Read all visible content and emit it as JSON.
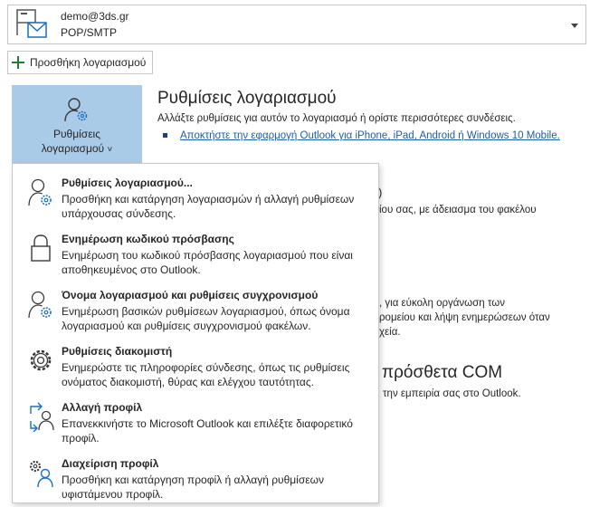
{
  "account": {
    "email": "demo@3ds.gr",
    "type": "POP/SMTP"
  },
  "add_account": {
    "label": "Προσθήκη λογαριασμού"
  },
  "big_button": {
    "line1": "Ρυθμίσεις",
    "line2": "λογαριασμού",
    "chevron": "˅"
  },
  "section": {
    "title": "Ρυθμίσεις λογαριασμού",
    "description": "Αλλάξτε ρυθμίσεις για αυτόν το λογαριασμό ή ορίστε περισσότερες συνδέσεις.",
    "link": "Αποκτήστε την εφαρμογή Outlook για iPhone, iPad, Android ή Windows 10 Mobile."
  },
  "background": {
    "t1": ")",
    "t2": "ίου σας, με άδειασμα του φακέλου",
    "t3": ", για εύκολη οργάνωση των",
    "t4": "ρομείου και λήψη ενημερώσεων όταν",
    "t5": "χεία.",
    "t6": "πρόσθετα COM",
    "t7": "την εμπειρία σας στο Outlook."
  },
  "menu": {
    "items": [
      {
        "title": "Ρυθμίσεις λογαριασμού...",
        "desc": "Προσθήκη και κατάργηση λογαριασμών ή αλλαγή ρυθμίσεων υπάρχουσας σύνδεσης.",
        "icon": "person-gear-icon"
      },
      {
        "title": "Ενημέρωση κωδικού πρόσβασης",
        "desc": "Ενημέρωση του κωδικού πρόσβασης λογαριασμού που είναι αποθηκευμένος στο Outlook.",
        "icon": "lock-icon"
      },
      {
        "title": "Όνομα λογαριασμού και ρυθμίσεις συγχρονισμού",
        "desc": "Ενημέρωση βασικών ρυθμίσεων λογαριασμού, όπως όνομα λογαριασμού και ρυθμίσεις συγχρονισμού φακέλων.",
        "icon": "person-gear-icon"
      },
      {
        "title": "Ρυθμίσεις διακομιστή",
        "desc": "Ενημερώστε τις πληροφορίες σύνδεσης, όπως τις ρυθμίσεις ονόματος διακομιστή, θύρας και ελέγχου ταυτότητας.",
        "icon": "gear-icon"
      },
      {
        "title": "Αλλαγή προφίλ",
        "desc": "Επανεκκινήστε το Microsoft Outlook και επιλέξτε διαφορετικό προφίλ.",
        "icon": "switch-profile-icon"
      },
      {
        "title": "Διαχείριση προφίλ",
        "desc": "Προσθήκη και κατάργηση προφίλ ή αλλαγή ρυθμίσεων υφιστάμενου προφίλ.",
        "icon": "manage-profile-icon"
      }
    ]
  }
}
